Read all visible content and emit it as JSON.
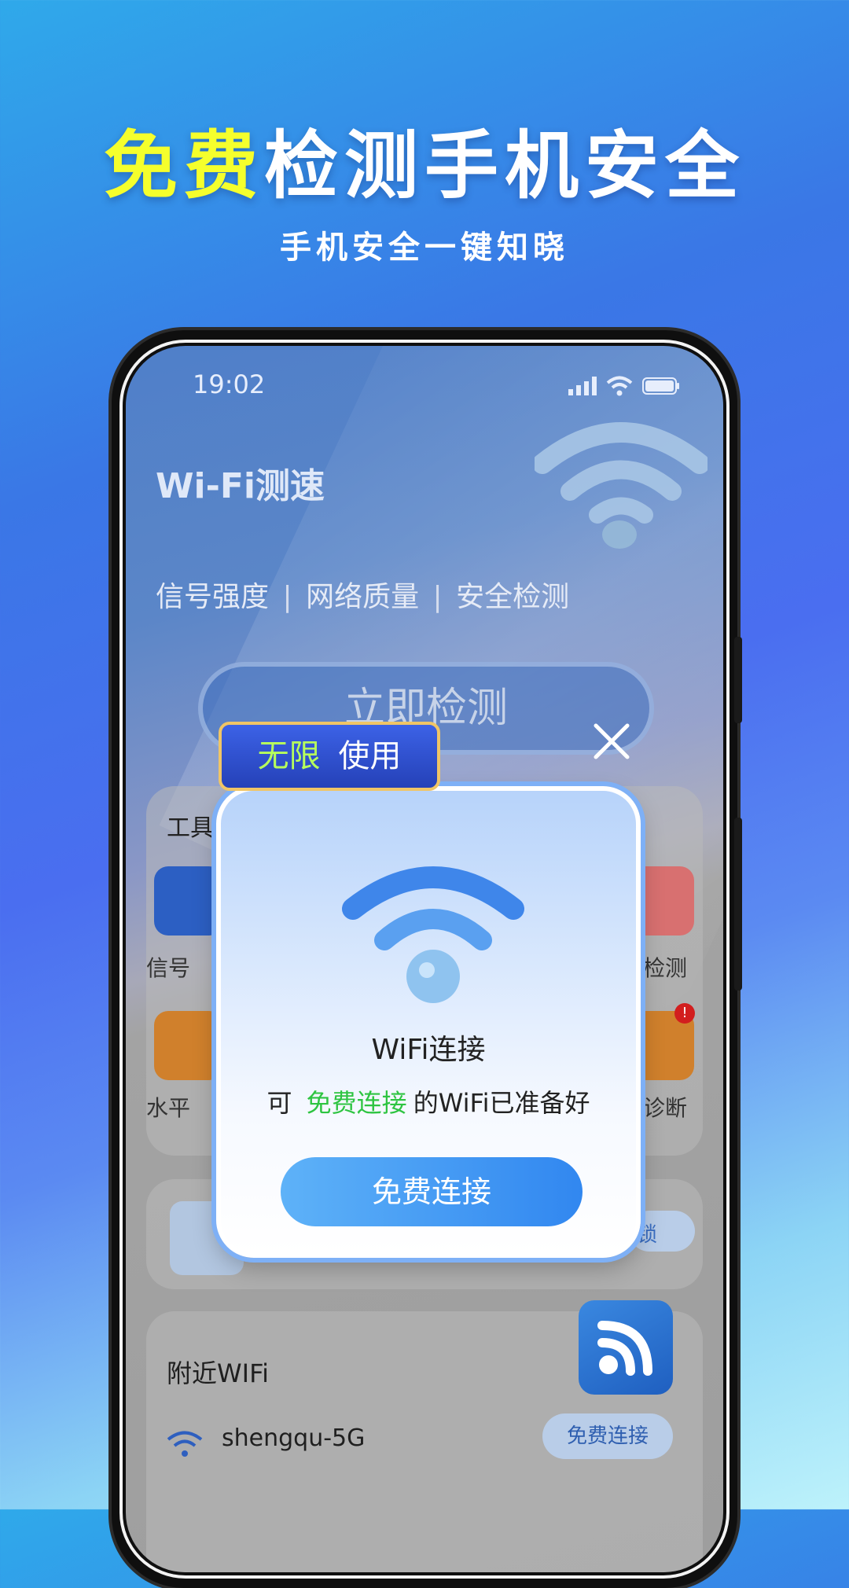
{
  "header": {
    "headline_highlight": "免费",
    "headline_rest": "检测手机安全",
    "subheadline": "手机安全一键知晓"
  },
  "status_bar": {
    "time": "19:02"
  },
  "app": {
    "title": "Wi-Fi测速",
    "features": [
      "信号强度",
      "网络质量",
      "安全检测"
    ],
    "detect_button": "立即检测",
    "tools_label": "工具",
    "tool_labels": [
      "信号",
      "检测",
      "水平",
      "诊断"
    ],
    "unlock_label": "锁",
    "nearby_label": "附近WIFi",
    "nearby_wifi": [
      {
        "name": "shengqu-5G",
        "button": "免费连接"
      }
    ]
  },
  "badge": {
    "highlight": "无限",
    "rest": "使用"
  },
  "popup": {
    "title": "WiFi连接",
    "desc_prefix": "可",
    "desc_highlight": "免费连接",
    "desc_suffix": "的WiFi已准备好",
    "button": "免费连接"
  },
  "colors": {
    "highlight_yellow": "#f5ff2c",
    "green": "#2ec441",
    "primary_blue": "#3187f0"
  }
}
